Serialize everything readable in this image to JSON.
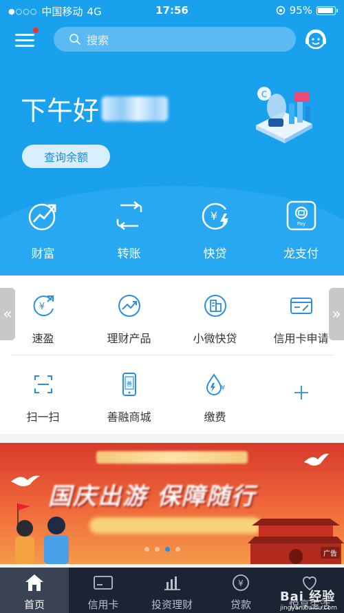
{
  "status_bar": {
    "signal": "●○○○",
    "carrier": "中国移动",
    "network": "4G",
    "time": "17:56",
    "battery": "95%"
  },
  "header": {
    "search_placeholder": "搜索"
  },
  "hero": {
    "greeting": "下午好",
    "balance_button": "查询余额"
  },
  "quick_actions": [
    {
      "label": "财富",
      "icon": "chart-up-icon"
    },
    {
      "label": "转账",
      "icon": "transfer-icon"
    },
    {
      "label": "快贷",
      "icon": "yuan-bolt-icon"
    },
    {
      "label": "龙支付",
      "icon": "pay-card-icon"
    }
  ],
  "services_row1": [
    {
      "label": "速盈",
      "icon": "yuan-arrows-icon"
    },
    {
      "label": "理财产品",
      "icon": "trend-circle-icon"
    },
    {
      "label": "小微快贷",
      "icon": "building-icon"
    },
    {
      "label": "信用卡申请",
      "icon": "card-edit-icon"
    }
  ],
  "services_row2": [
    {
      "label": "扫一扫",
      "icon": "scan-icon"
    },
    {
      "label": "善融商城",
      "icon": "phone-shop-icon"
    },
    {
      "label": "缴费",
      "icon": "drop-yuan-icon"
    },
    {
      "label": "+",
      "icon": "plus-icon"
    }
  ],
  "banner": {
    "headline": "国庆出游 保障随行",
    "ad_label": "广告"
  },
  "tabbar": [
    {
      "label": "首页",
      "icon": "home-icon"
    },
    {
      "label": "信用卡",
      "icon": "credit-card-icon"
    },
    {
      "label": "投资理财",
      "icon": "bar-chart-icon"
    },
    {
      "label": "贷款",
      "icon": "loan-icon"
    },
    {
      "label": "悦享生活",
      "icon": "life-icon"
    }
  ],
  "watermark": {
    "brand": "Bai 经验",
    "url": "jingyan.baidu.com"
  },
  "colors": {
    "primary_blue": "#1aa1ee",
    "tabbar_bg": "#1c2433",
    "banner_red": "#d83a2c"
  }
}
